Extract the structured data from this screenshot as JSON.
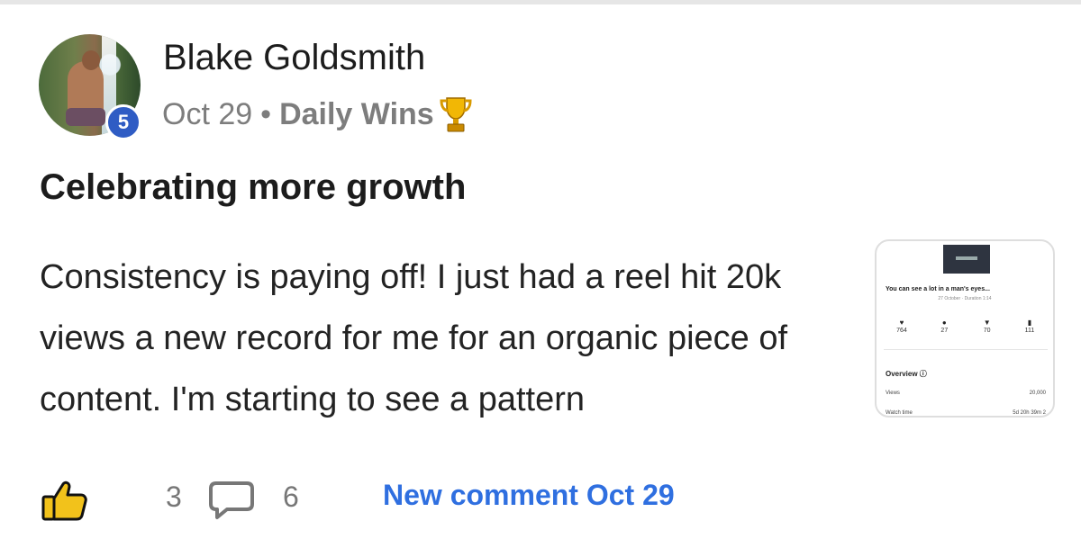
{
  "post": {
    "author_name": "Blake Goldsmith",
    "level": "5",
    "date": "Oct 29",
    "separator": "•",
    "category": "Daily Wins",
    "title": "Celebrating more growth",
    "body": "Consistency is paying off! I just had a reel hit 20k views a new record for me for an organic piece of content. I'm starting to see a pattern"
  },
  "attachment": {
    "caption": "You can see a lot in a man's eyes...",
    "subcaption": "27 October · Duration 1:14",
    "stats": [
      {
        "icon": "heart-icon",
        "glyph": "♥",
        "value": "764"
      },
      {
        "icon": "comment-icon",
        "glyph": "●",
        "value": "27"
      },
      {
        "icon": "share-icon",
        "glyph": "▼",
        "value": "70"
      },
      {
        "icon": "bookmark-icon",
        "glyph": "▮",
        "value": "111"
      }
    ],
    "overview_label": "Overview ⓘ",
    "rows": [
      {
        "label": "Views",
        "value": "20,000"
      },
      {
        "label": "Watch time",
        "value": "5d 20h 39m 2"
      }
    ]
  },
  "actions": {
    "like_count": "3",
    "comment_count": "6",
    "new_comment_label": "New comment Oct 29"
  },
  "colors": {
    "accent": "#2f6fe0",
    "level_badge": "#2f5cc4",
    "like_icon": "#f2c21b",
    "meta_text": "#7d7d7d"
  }
}
